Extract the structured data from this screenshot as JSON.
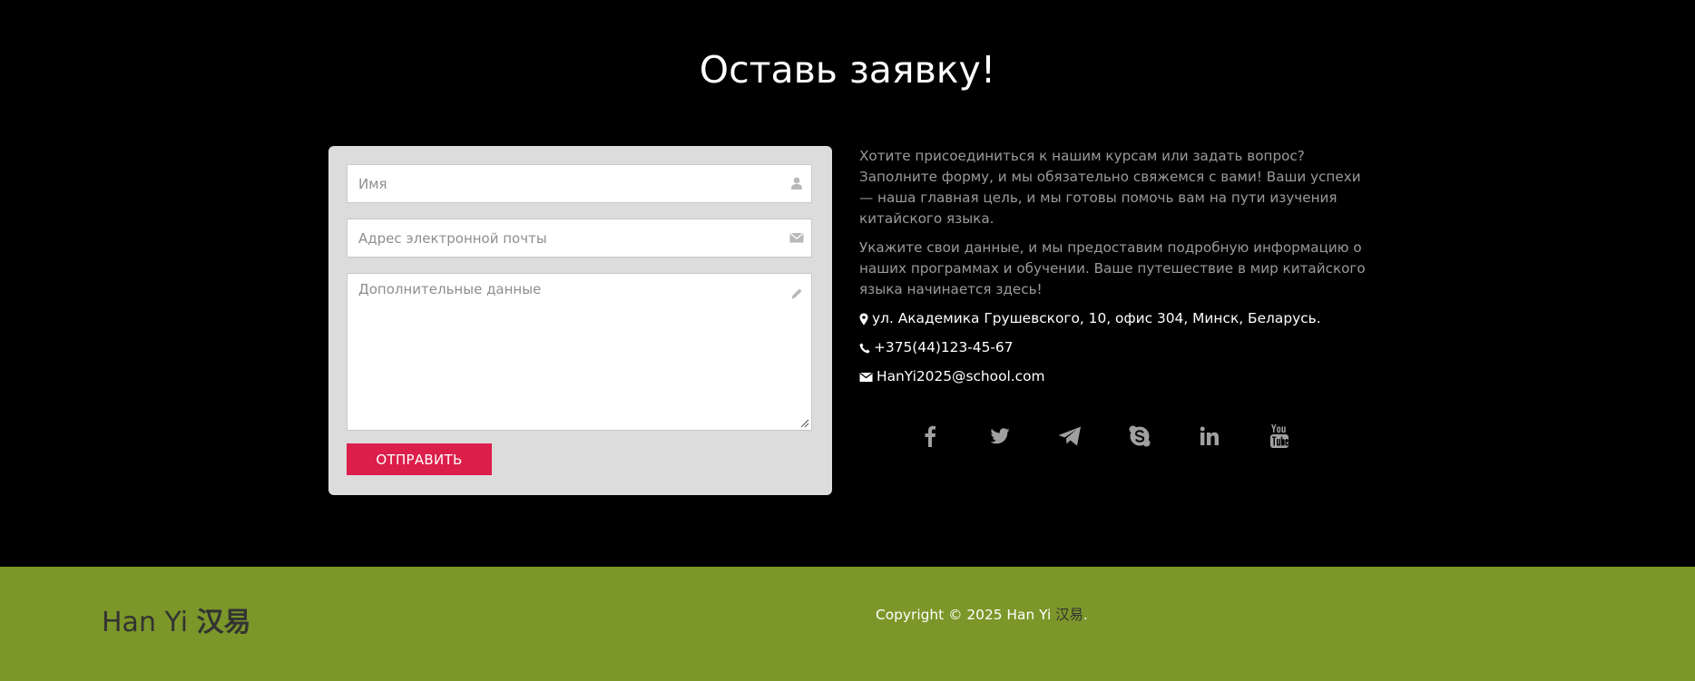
{
  "section": {
    "title": "Оставь заявку!"
  },
  "form": {
    "name_placeholder": "Имя",
    "email_placeholder": "Адрес электронной почты",
    "extra_placeholder": "Дополнительные данные",
    "submit_label": "ОТПРАВИТЬ",
    "icons": [
      "user-icon",
      "envelope-icon",
      "pencil-icon"
    ]
  },
  "info": {
    "paragraph1": "Хотите присоединиться к нашим курсам или задать вопрос? Заполните форму, и мы обязательно свяжемся с вами! Ваши успехи — наша главная цель, и мы готовы помочь вам на пути изучения китайского языка.",
    "paragraph2": "Укажите свои данные, и мы предоставим подробную информацию о наших программах и обучении. Ваше путешествие в мир китайского языка начинается здесь!",
    "address": "ул. Академика Грушевского, 10, офис 304, Минск, Беларусь.",
    "phone": "+375(44)123-45-67",
    "email": "HanYi2025@school.com"
  },
  "socials": [
    "facebook-icon",
    "twitter-icon",
    "telegram-icon",
    "skype-icon",
    "linkedin-icon",
    "youtube-icon"
  ],
  "footer": {
    "brand_latin": "Han Yi",
    "brand_cn": "汉易",
    "copyright_prefix": "Copyright © 2025 Han Yi",
    "copyright_cn": "汉易",
    "copyright_suffix": "."
  },
  "colors": {
    "background": "#000000",
    "card": "#dcdcdc",
    "accent": "#dc1e4a",
    "footer": "#7b9729",
    "muted_text": "#9a9a9a"
  }
}
